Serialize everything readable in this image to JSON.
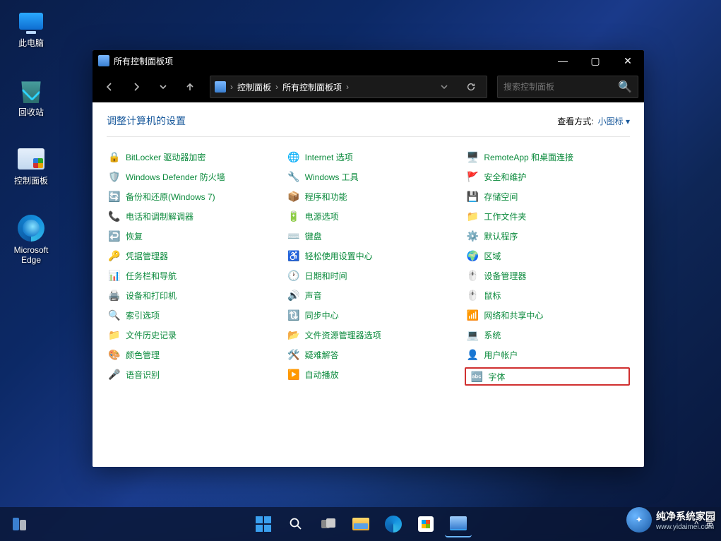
{
  "desktop": {
    "icons": [
      {
        "label": "此电脑"
      },
      {
        "label": "回收站"
      },
      {
        "label": "控制面板"
      },
      {
        "label": "Microsoft Edge"
      }
    ]
  },
  "window": {
    "title": "所有控制面板项",
    "breadcrumb": {
      "root": "控制面板",
      "current": "所有控制面板项"
    },
    "search_placeholder": "搜索控制面板",
    "heading": "调整计算机的设置",
    "view_by_label": "查看方式:",
    "view_by_value": "小图标"
  },
  "items": {
    "col1": [
      {
        "label": "BitLocker 驱动器加密",
        "icon": "🔒"
      },
      {
        "label": "Windows Defender 防火墙",
        "icon": "🛡️"
      },
      {
        "label": "备份和还原(Windows 7)",
        "icon": "🔄"
      },
      {
        "label": "电话和调制解调器",
        "icon": "📞"
      },
      {
        "label": "恢复",
        "icon": "↩️"
      },
      {
        "label": "凭据管理器",
        "icon": "🔑"
      },
      {
        "label": "任务栏和导航",
        "icon": "📊"
      },
      {
        "label": "设备和打印机",
        "icon": "🖨️"
      },
      {
        "label": "索引选项",
        "icon": "🔍"
      },
      {
        "label": "文件历史记录",
        "icon": "📁"
      },
      {
        "label": "颜色管理",
        "icon": "🎨"
      },
      {
        "label": "语音识别",
        "icon": "🎤"
      }
    ],
    "col2": [
      {
        "label": "Internet 选项",
        "icon": "🌐"
      },
      {
        "label": "Windows 工具",
        "icon": "🔧"
      },
      {
        "label": "程序和功能",
        "icon": "📦"
      },
      {
        "label": "电源选项",
        "icon": "🔋"
      },
      {
        "label": "键盘",
        "icon": "⌨️"
      },
      {
        "label": "轻松使用设置中心",
        "icon": "♿"
      },
      {
        "label": "日期和时间",
        "icon": "🕐"
      },
      {
        "label": "声音",
        "icon": "🔊"
      },
      {
        "label": "同步中心",
        "icon": "🔃"
      },
      {
        "label": "文件资源管理器选项",
        "icon": "📂"
      },
      {
        "label": "疑难解答",
        "icon": "🛠️"
      },
      {
        "label": "自动播放",
        "icon": "▶️"
      }
    ],
    "col3": [
      {
        "label": "RemoteApp 和桌面连接",
        "icon": "🖥️"
      },
      {
        "label": "安全和维护",
        "icon": "🚩"
      },
      {
        "label": "存储空间",
        "icon": "💾"
      },
      {
        "label": "工作文件夹",
        "icon": "📁"
      },
      {
        "label": "默认程序",
        "icon": "⚙️"
      },
      {
        "label": "区域",
        "icon": "🌍"
      },
      {
        "label": "设备管理器",
        "icon": "🖱️"
      },
      {
        "label": "鼠标",
        "icon": "🖱️"
      },
      {
        "label": "网络和共享中心",
        "icon": "📶"
      },
      {
        "label": "系统",
        "icon": "💻"
      },
      {
        "label": "用户帐户",
        "icon": "👤"
      },
      {
        "label": "字体",
        "icon": "🔤",
        "highlighted": true
      }
    ]
  },
  "watermark": {
    "line1": "纯净系统家园",
    "line2": "www.yidaimei.com"
  },
  "tray": {
    "chevron": "^",
    "lang": "英"
  }
}
